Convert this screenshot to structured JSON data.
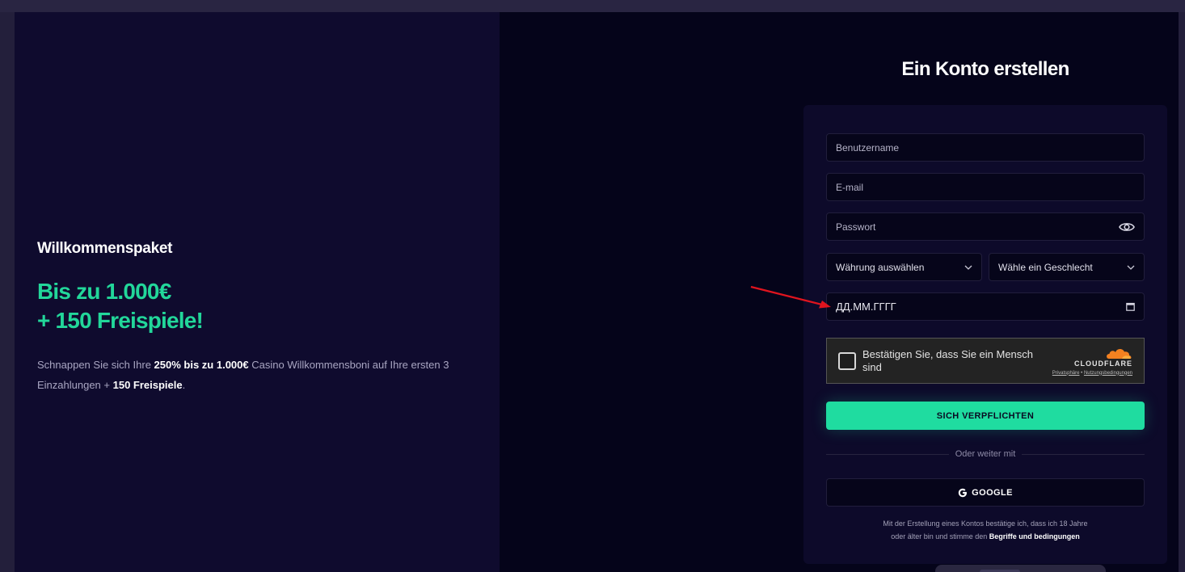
{
  "promo": {
    "label": "Willkommenspaket",
    "headline_line1": "Bis zu 1.000€",
    "headline_line2": "+ 150 Freispiele!",
    "desc": {
      "p1": "Schnappen Sie sich Ihre ",
      "b1": "250% bis zu 1.000€",
      "p2": " Casino Willkommensboni auf Ihre ersten 3 Einzahlungen + ",
      "b2": "150 Freispiele",
      "p3": "."
    }
  },
  "form": {
    "title": "Ein Konto erstellen",
    "username_placeholder": "Benutzername",
    "email_placeholder": "E-mail",
    "password_placeholder": "Passwort",
    "currency_select": "Währung auswählen",
    "gender_select": "Wähle ein Geschlecht",
    "date_placeholder": "ДД.ММ.ГГГГ",
    "captcha": {
      "text": "Bestätigen Sie, dass Sie ein Mensch sind",
      "brand": "CLOUDFLARE",
      "privacy": "Privatsphäre",
      "separator": "•",
      "terms": "Nutzungsbedingungen"
    },
    "submit_label": "SICH VERPFLICHTEN",
    "divider_text": "Oder weiter mit",
    "google_label": "GOOGLE",
    "terms_line1": "Mit der Erstellung eines Kontos bestätige ich, dass ich 18 Jahre",
    "terms_line2": "oder älter bin und stimme den ",
    "terms_link": "Begriffe und bedingungen"
  },
  "colors": {
    "accent": "#1fdca0",
    "headline": "#22d79a",
    "annotation_arrow": "#e0141e"
  },
  "icons": {
    "password_toggle": "eye-icon",
    "select_arrow": "chevron-down-icon",
    "date_picker": "calendar-icon",
    "google": "google-g-icon",
    "cloudflare": "cloudflare-cloud-icon"
  }
}
